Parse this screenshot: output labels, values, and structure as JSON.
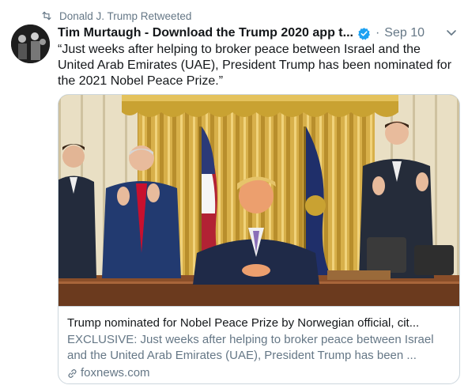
{
  "retweet": {
    "label": "Donald J. Trump Retweeted",
    "icon": "retweet-icon"
  },
  "tweet": {
    "display_name": "Tim Murtaugh - Download the Trump 2020 app t...",
    "verified_icon": "verified-badge-icon",
    "separator": "·",
    "date": "Sep 10",
    "text": "“Just weeks after helping to broker peace between Israel and the\nUnited Arab Emirates (UAE), President Trump has been nominated for\nthe 2021 Nobel Peace Prize.”",
    "avatar_icon": "avatar-icon",
    "menu_icon": "chevron-down-icon"
  },
  "card": {
    "title": "Trump nominated for Nobel Peace Prize by Norwegian official, cit...",
    "description_line1": "EXCLUSIVE: Just weeks after helping to broker peace between Israel",
    "description_line2": "and the United Arab Emirates (UAE), President Trump has been ...",
    "domain": "foxnews.com",
    "link_icon": "link-icon"
  },
  "colors": {
    "accent": "#1da1f2",
    "secondary_text": "#657786",
    "primary_text": "#14171a",
    "border": "#ccd6dd"
  }
}
